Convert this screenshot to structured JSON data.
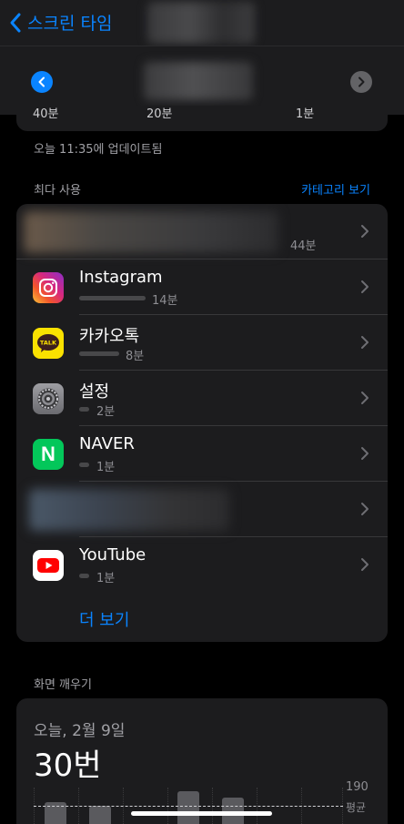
{
  "nav": {
    "back_label": "스크린 타임"
  },
  "strip": {
    "left": "40분",
    "mid": "20분",
    "right": "1분"
  },
  "updated": "오늘 11:35에 업데이트됨",
  "most_used": {
    "label": "최다 사용",
    "category_link": "카테고리 보기",
    "apps": [
      {
        "name": "",
        "time": "44분",
        "usage_fraction": 1.0
      },
      {
        "name": "Instagram",
        "time": "14분",
        "usage_fraction": 0.32
      },
      {
        "name": "카카오톡",
        "time": "8분",
        "usage_fraction": 0.18
      },
      {
        "name": "설정",
        "time": "2분",
        "usage_fraction": 0.05
      },
      {
        "name": "NAVER",
        "time": "1분",
        "usage_fraction": 0.03
      },
      {
        "name": "",
        "time": "",
        "usage_fraction": 0
      },
      {
        "name": "YouTube",
        "time": "1분",
        "usage_fraction": 0.03
      }
    ],
    "more_label": "더 보기"
  },
  "pickups": {
    "label": "화면 깨우기",
    "date": "오늘, 2월 9일",
    "count": "30번",
    "max_label": "190",
    "avg_label": "평균"
  },
  "icons": {
    "kakao_talk_text": "TALK",
    "naver_letter": "N"
  },
  "colors": {
    "accent": "#0a84ff",
    "background": "#000000",
    "card": "#1c1c1e"
  }
}
